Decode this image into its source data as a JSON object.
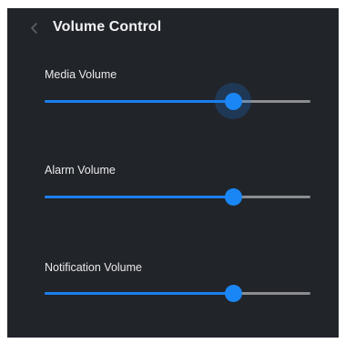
{
  "header": {
    "title": "Volume Control",
    "back_icon": "chevron-left-icon"
  },
  "sliders": [
    {
      "label": "Media Volume",
      "value": 0.71,
      "focused": true
    },
    {
      "label": "Alarm Volume",
      "value": 0.71,
      "focused": false
    },
    {
      "label": "Notification Volume",
      "value": 0.71,
      "focused": false
    }
  ],
  "colors": {
    "background": "#212429",
    "accent": "#1a7ff0",
    "track_inactive": "#8b8d91",
    "text": "#e9eaec"
  }
}
